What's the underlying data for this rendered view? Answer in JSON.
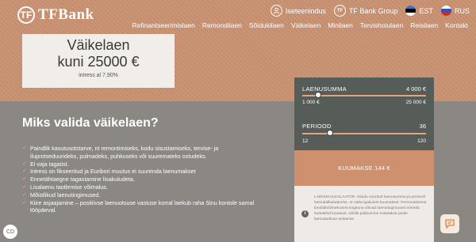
{
  "brand": {
    "logo_mark": "TF",
    "name": "TFBank"
  },
  "topbar": {
    "self_service": "Iseteenindus",
    "group": "TF Bank Group",
    "lang_est": "EST",
    "lang_rus": "RUS",
    "group_mark": "TF"
  },
  "nav": [
    "Refinantseerimislaen",
    "Remondilaen",
    "Sõidukilaen",
    "Väikelaen",
    "Minilaen",
    "Tervishoiulaen",
    "Reisilaen",
    "Kontakt"
  ],
  "promo": {
    "title": "Väikelaen",
    "amount": "kuni 25000 €",
    "rate": "intress al 7,90%"
  },
  "calculator": {
    "amount_label": "LAENUSUMMA",
    "amount_value": "4 000 €",
    "amount_min": "1 000 €",
    "amount_max": "25 000 €",
    "amount_fraction": 0.125,
    "period_label": "PERIOOD",
    "period_value": "36",
    "period_min": "12",
    "period_max": "120",
    "period_fraction": 0.222,
    "monthly": "KUUMAKSE 144 €",
    "info_icon_glyph": "i",
    "info_text": "LAENUKALKULAATOR. Siiadu sooritud laenusumma ja perioodi laenukalkulaatorise. et näha igakuiset kuumakset. Personaliseest krediidivõimekusest tingituna võivad laenutingimused erineda kodulehel kuvatust. Isikliik pakkumine esitatakse pesle laenutaotluse esitamist"
  },
  "section": {
    "title": "Miks valida väikelaen?",
    "features": [
      "Paindlik kasutusotstarve, nt remontimiseks, kodu sisustamiseks, tervise- ja iluprotseduurideks, pulmadeks, puhkuseks või suuremateks ostudeks.",
      "Ei vaja tagatist.",
      "Intress on fikseeritud ja Euribori muutus ei suurenda laenumakset",
      "Ennetähtaegne tagastamine lisakuludeta.",
      "Lisalaenu taotlemise võimalus.",
      "Mõistlikud laenutingimused.",
      "Kiire asjaajamine – positiivse laenuotsuse vastuse korral laekub raha Sinu kontole samal tööpäeval."
    ]
  },
  "floating": {
    "cookie_label": "CD"
  },
  "colors": {
    "accent": "#e9a57c",
    "hero": "#c99272",
    "calc_dark": "#565c58"
  }
}
